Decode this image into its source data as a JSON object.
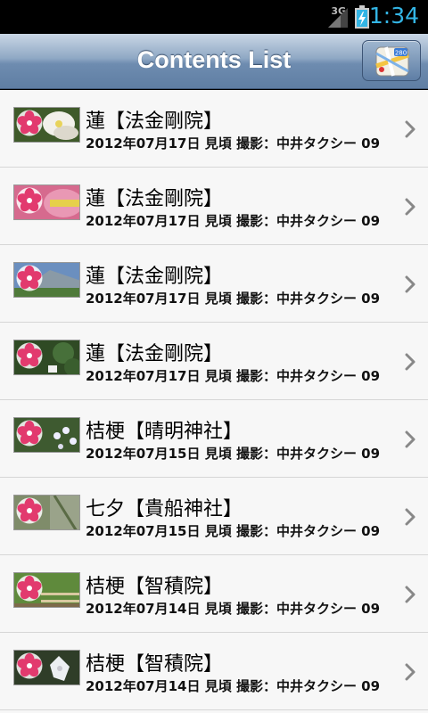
{
  "status": {
    "network": "3G",
    "time": "1:34"
  },
  "header": {
    "title": "Contents List",
    "map_button_icon": "map-icon"
  },
  "items": [
    {
      "title": "蓮【法金剛院】",
      "subtitle": "2012年07月17日 見頃 撮影：中井タクシー 09",
      "thumb": "white-lotus"
    },
    {
      "title": "蓮【法金剛院】",
      "subtitle": "2012年07月17日 見頃 撮影：中井タクシー 09",
      "thumb": "pink-lotus"
    },
    {
      "title": "蓮【法金剛院】",
      "subtitle": "2012年07月17日 見頃 撮影：中井タクシー 09",
      "thumb": "temple-roof"
    },
    {
      "title": "蓮【法金剛院】",
      "subtitle": "2012年07月17日 見頃 撮影：中井タクシー 09",
      "thumb": "garden-greenery"
    },
    {
      "title": "桔梗【晴明神社】",
      "subtitle": "2012年07月15日 見頃 撮影：中井タクシー 09",
      "thumb": "bellflowers"
    },
    {
      "title": "七夕【貴船神社】",
      "subtitle": "2012年07月15日 見頃 撮影：中井タクシー 09",
      "thumb": "tanabata"
    },
    {
      "title": "桔梗【智積院】",
      "subtitle": "2012年07月14日 見頃 撮影：中井タクシー 09",
      "thumb": "garden-fence"
    },
    {
      "title": "桔梗【智積院】",
      "subtitle": "2012年07月14日 見頃 撮影：中井タクシー 09",
      "thumb": "white-bellflower"
    }
  ],
  "colors": {
    "badge_flower": "#e23a6e",
    "clock": "#33b5e5",
    "header_mid": "#6e8cb0"
  }
}
